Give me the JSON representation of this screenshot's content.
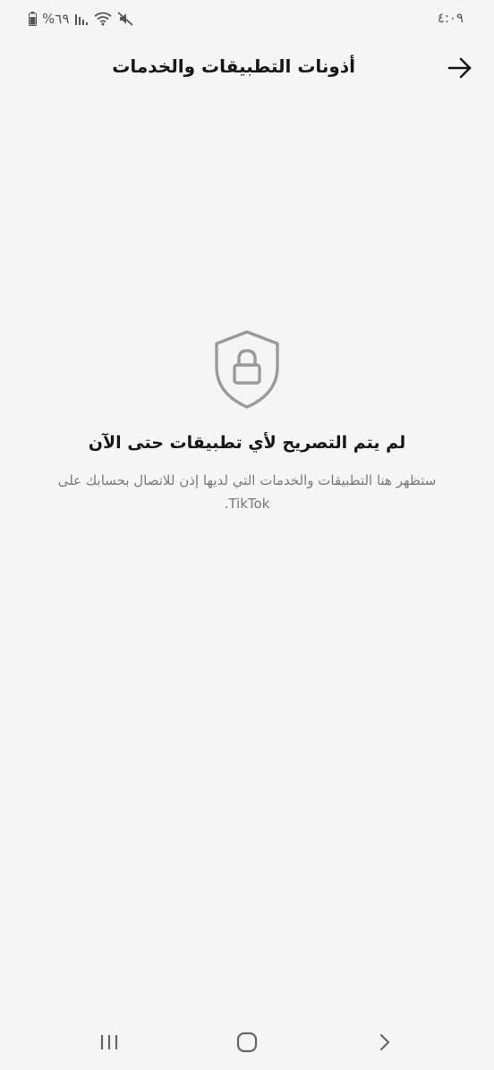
{
  "status_bar": {
    "time": "٤:٠٩",
    "battery": "%٦٩"
  },
  "header": {
    "title": "أذونات التطبيقات والخدمات"
  },
  "empty_state": {
    "title": "لم يتم التصريح لأي تطبيقات حتى الآن",
    "description": "ستظهر هنا التطبيقات والخدمات التي لديها إذن للاتصال بحسابك على TikTok."
  },
  "icons": {
    "back": "arrow-right-icon",
    "empty": "shield-lock-icon"
  },
  "colors": {
    "background": "#f5f5f5",
    "text_primary": "#161616",
    "text_secondary": "#7a7a7a",
    "icon_gray": "#9a9a9a"
  }
}
